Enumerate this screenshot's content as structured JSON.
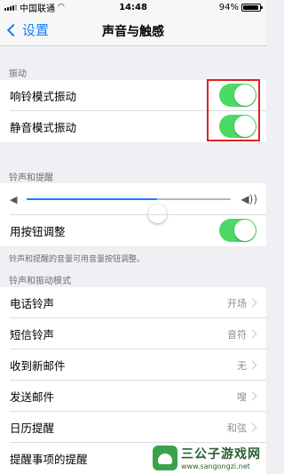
{
  "status_bar": {
    "carrier": "中国联通",
    "time": "14:48",
    "battery": "94%",
    "battery_level": 0.94
  },
  "nav": {
    "back_label": "设置",
    "title": "声音与触感"
  },
  "sections": {
    "vibration": {
      "header": "振动",
      "rows": [
        {
          "label": "响铃模式振动",
          "on": true
        },
        {
          "label": "静音模式振动",
          "on": true
        }
      ]
    },
    "ringer": {
      "header": "铃声和提醒",
      "volume_level": 0.64,
      "button_adjust_label": "用按钮调整",
      "button_adjust_on": true,
      "footnote": "铃声和提醒的音量可用音量按钮调整。"
    },
    "patterns": {
      "header": "铃声和振动模式",
      "rows": [
        {
          "label": "电话铃声",
          "value": "开场"
        },
        {
          "label": "短信铃声",
          "value": "音符"
        },
        {
          "label": "收到新邮件",
          "value": "无"
        },
        {
          "label": "发送邮件",
          "value": "嗖"
        },
        {
          "label": "日历提醒",
          "value": "和弦"
        },
        {
          "label": "提醒事项的提醒",
          "value": ""
        }
      ]
    }
  },
  "watermark": {
    "name": "三公子游戏网",
    "url": "www.sangongzi.net"
  },
  "colors": {
    "accent": "#147efb",
    "toggle_on": "#4cd964",
    "highlight": "#e02020"
  },
  "icons": {
    "back": "chevron-left-icon",
    "wifi": "wifi-icon",
    "volume_low": "speaker-low-icon",
    "volume_high": "speaker-high-icon"
  }
}
